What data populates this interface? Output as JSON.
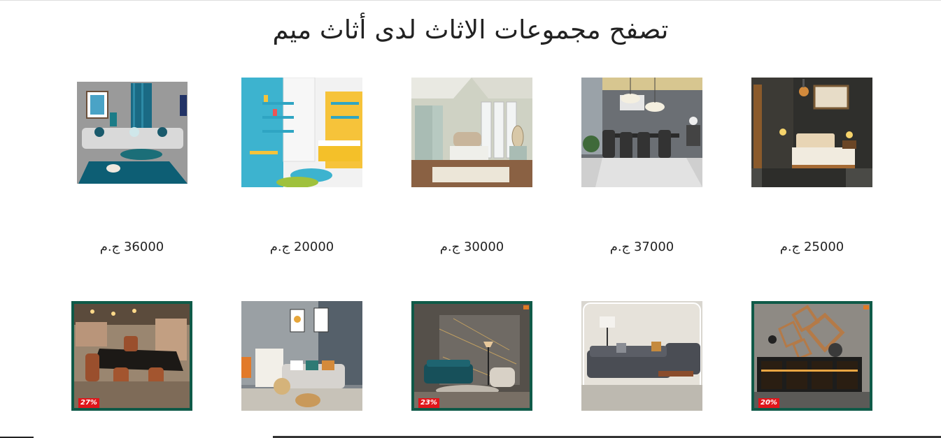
{
  "header": {
    "title": "تصفح مجموعات الاثاث لدى أثاث ميم"
  },
  "row1": [
    {
      "image": "bedroom-lamp-image",
      "price": "25000 ج.م"
    },
    {
      "image": "dining-room-image",
      "price": "37000 ج.م"
    },
    {
      "image": "mint-bedroom-image",
      "price": "30000 ج.م"
    },
    {
      "image": "kids-room-image",
      "price": "20000 ج.م"
    },
    {
      "image": "teal-living-room-image",
      "price": "36000 ج.م"
    }
  ],
  "row2": [
    {
      "image": "mirror-console-image",
      "discount": "20%"
    },
    {
      "image": "corner-sofa-image"
    },
    {
      "image": "teal-sofa-image",
      "discount": "23%"
    },
    {
      "image": "grey-living-room-image"
    },
    {
      "image": "dining-set-image",
      "discount": "27%"
    }
  ],
  "colors": {
    "frame_green": "#0f5a48",
    "badge_red": "#e0161b"
  }
}
